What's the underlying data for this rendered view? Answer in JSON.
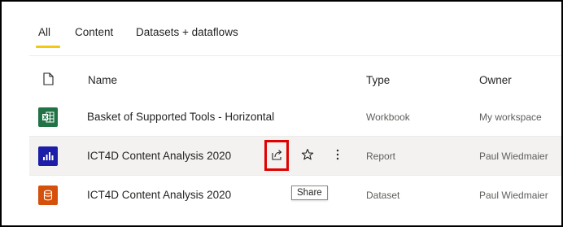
{
  "tabs": [
    {
      "label": "All",
      "active": true
    },
    {
      "label": "Content"
    },
    {
      "label": "Datasets + dataflows"
    }
  ],
  "columns": {
    "name": "Name",
    "type": "Type",
    "owner": "Owner"
  },
  "rows": [
    {
      "name": "Basket of Supported Tools - Horizontal",
      "type": "Workbook",
      "owner": "My workspace",
      "icon": "excel-workbook-icon",
      "icon_color": "#217346"
    },
    {
      "name": "ICT4D Content Analysis 2020",
      "type": "Report",
      "owner": "Paul Wiedmaier",
      "icon": "report-icon",
      "icon_color": "#1c1ea8"
    },
    {
      "name": "ICT4D Content Analysis 2020",
      "type": "Dataset",
      "owner": "Paul Wiedmaier",
      "icon": "dataset-icon",
      "icon_color": "#d5500b"
    }
  ],
  "tooltip": {
    "text": "Share"
  },
  "colors": {
    "tab_underline": "#f2c811",
    "highlight_box": "#e00000",
    "hover_row": "#f3f2f1"
  }
}
